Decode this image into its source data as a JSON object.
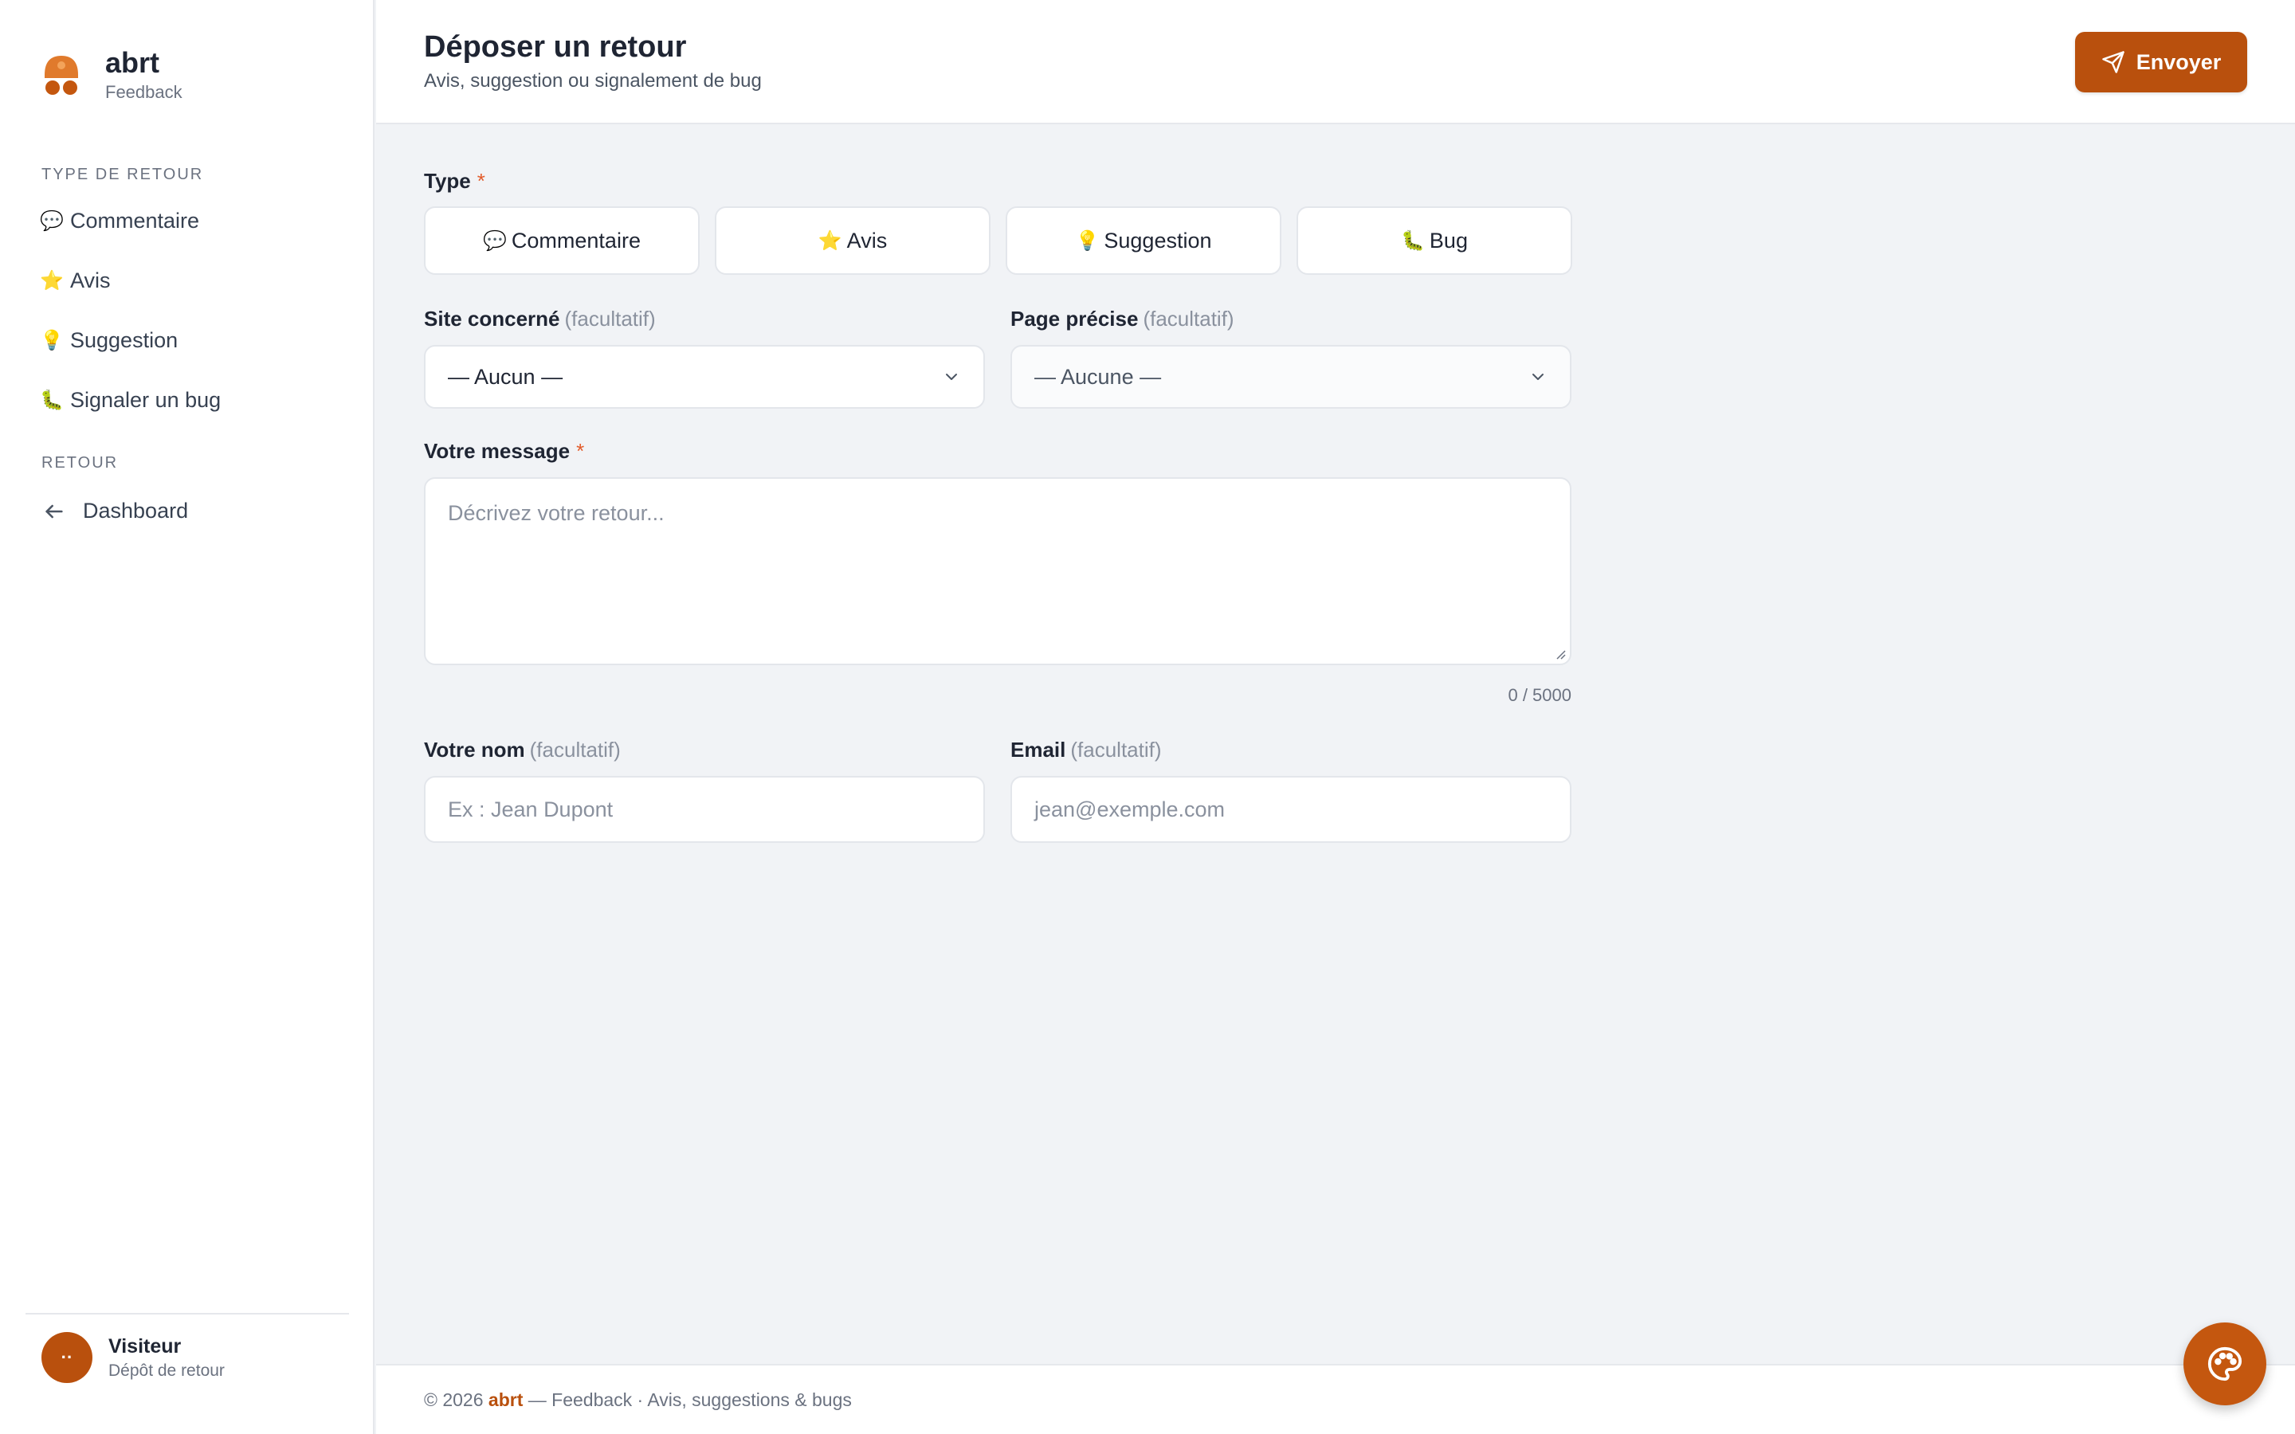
{
  "brand": {
    "name": "abrt",
    "subtitle": "Feedback"
  },
  "sidebar": {
    "section_type": "TYPE DE RETOUR",
    "items": [
      {
        "emoji": "💬",
        "label": "Commentaire"
      },
      {
        "emoji": "⭐",
        "label": "Avis"
      },
      {
        "emoji": "💡",
        "label": "Suggestion"
      },
      {
        "emoji": "🐛",
        "label": "Signaler un bug"
      }
    ],
    "section_back": "RETOUR",
    "back_item": {
      "label": "Dashboard",
      "icon": "arrow-left-icon"
    }
  },
  "user": {
    "initials": "··",
    "name": "Visiteur",
    "role": "Dépôt de retour"
  },
  "header": {
    "title": "Déposer un retour",
    "subtitle": "Avis, suggestion ou signalement de bug",
    "send_label": "Envoyer",
    "send_icon": "paper-plane-icon"
  },
  "form": {
    "type_label": "Type",
    "required_mark": "*",
    "types": [
      {
        "emoji": "💬",
        "label": "Commentaire"
      },
      {
        "emoji": "⭐",
        "label": "Avis"
      },
      {
        "emoji": "💡",
        "label": "Suggestion"
      },
      {
        "emoji": "🐛",
        "label": "Bug"
      }
    ],
    "site_label": "Site concerné",
    "page_label": "Page précise",
    "optional": "(facultatif)",
    "site_value": "— Aucun —",
    "page_value": "— Aucune —",
    "message_label": "Votre message",
    "message_placeholder": "Décrivez votre retour...",
    "counter": "0 / 5000",
    "name_label": "Votre nom",
    "name_placeholder": "Ex : Jean Dupont",
    "email_label": "Email",
    "email_placeholder": "jean@exemple.com"
  },
  "footer": {
    "prefix": "© 2026",
    "brand": "abrt",
    "suffix": "— Feedback · Avis, suggestions & bugs"
  },
  "colors": {
    "accent": "#b9500d",
    "required": "#e25b2a",
    "background": "#f1f3f6"
  }
}
